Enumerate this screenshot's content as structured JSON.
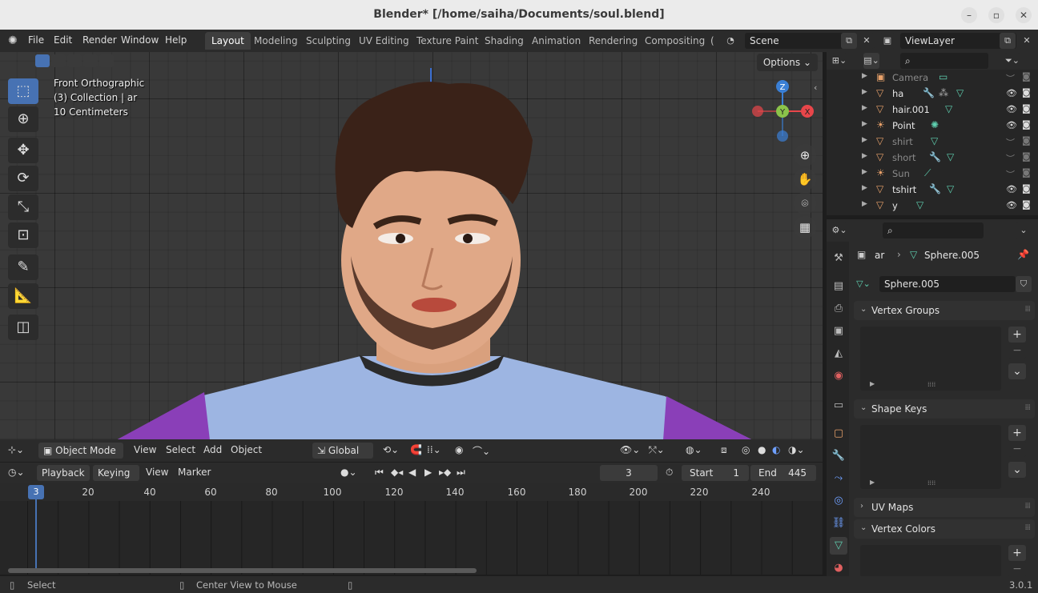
{
  "window": {
    "title": "Blender* [/home/saiha/Documents/soul.blend]",
    "controls": [
      "–",
      "▫",
      "✕"
    ]
  },
  "menu": [
    "File",
    "Edit",
    "Render",
    "Window",
    "Help"
  ],
  "workspaces": [
    "Layout",
    "Modeling",
    "Sculpting",
    "UV Editing",
    "Texture Paint",
    "Shading",
    "Animation",
    "Rendering",
    "Compositing",
    "("
  ],
  "active_workspace": "Layout",
  "scene": {
    "name": "Scene",
    "view_layer": "ViewLayer"
  },
  "viewport": {
    "options_label": "Options",
    "info_lines": [
      "Front Orthographic",
      "(3) Collection | ar",
      "10 Centimeters"
    ],
    "gizmo_axes": {
      "z": "Z",
      "y": "Y",
      "x": "X"
    },
    "axis_colors": {
      "x": "#e8464a",
      "y": "#8bc34a",
      "z": "#3a7fd5"
    },
    "footer": {
      "mode": "Object Mode",
      "menus": [
        "View",
        "Select",
        "Add",
        "Object"
      ],
      "orientation": "Global"
    }
  },
  "timeline": {
    "header": [
      "Playback",
      "Keying",
      "View",
      "Marker"
    ],
    "current_frame": "3",
    "start_label": "Start",
    "start": "1",
    "end_label": "End",
    "end": "445",
    "ticks": [
      "20",
      "40",
      "60",
      "80",
      "100",
      "120",
      "140",
      "160",
      "180",
      "200",
      "220",
      "240"
    ]
  },
  "outliner": {
    "items": [
      {
        "name": "Camera",
        "dim": true
      },
      {
        "name": "ha",
        "dim": false
      },
      {
        "name": "hair.001",
        "dim": false
      },
      {
        "name": "Point",
        "dim": false
      },
      {
        "name": "shirt",
        "dim": true
      },
      {
        "name": "short",
        "dim": true
      },
      {
        "name": "Sun",
        "dim": true
      },
      {
        "name": "tshirt",
        "dim": false
      },
      {
        "name": "y",
        "dim": false
      }
    ]
  },
  "properties": {
    "breadcrumb_object": "ar",
    "breadcrumb_data": "Sphere.005",
    "mesh_name": "Sphere.005",
    "panels": [
      "Vertex Groups",
      "Shape Keys",
      "UV Maps",
      "Vertex Colors"
    ]
  },
  "statusbar": {
    "left": "Select",
    "middle": "Center View to Mouse",
    "version": "3.0.1"
  }
}
